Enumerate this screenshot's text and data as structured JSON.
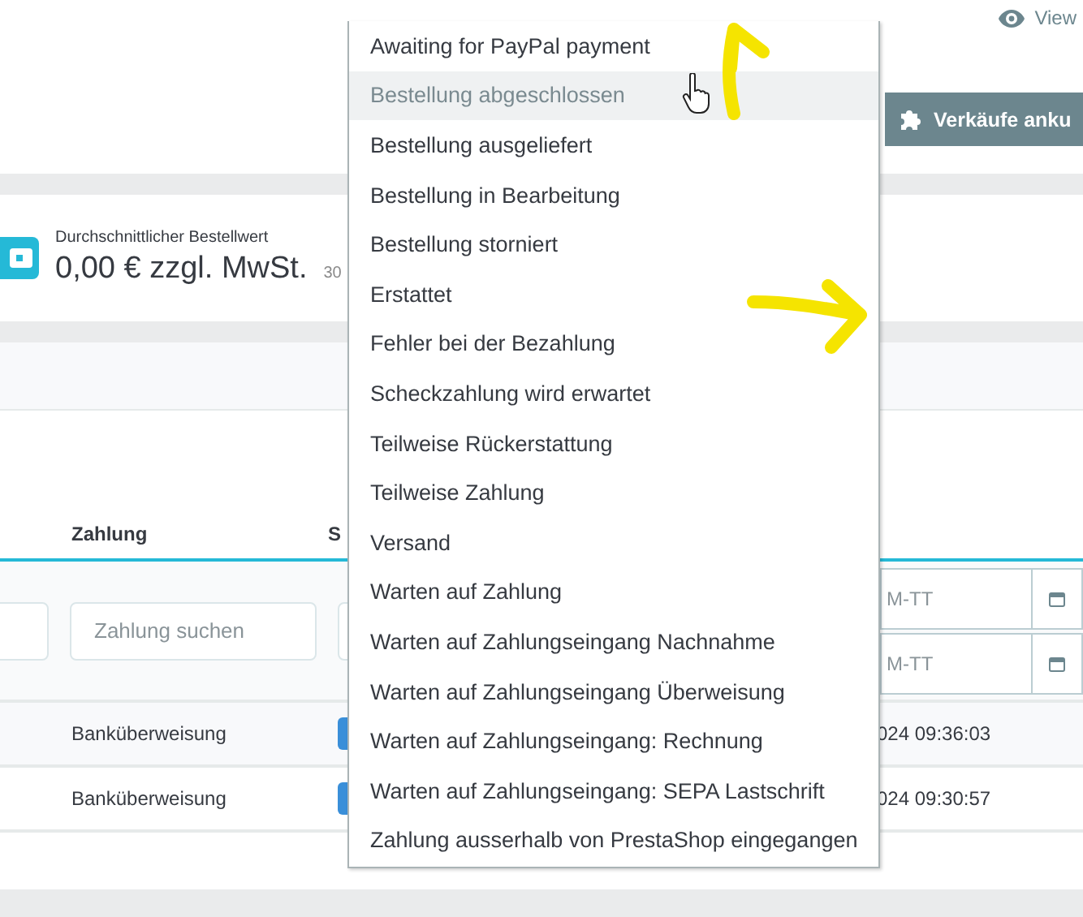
{
  "top_bar": {
    "view_link": "View"
  },
  "header_button": {
    "label": "Verkäufe anku"
  },
  "kpi": {
    "label": "Durchschnittlicher Bestellwert",
    "value": "0,00 € zzgl. MwSt.",
    "note": "30"
  },
  "table": {
    "columns": [
      {
        "label": "Zahlung"
      },
      {
        "label": "S"
      }
    ],
    "filters": {
      "payment_placeholder": "Zahlung suchen",
      "date_placeholders": [
        "M-TT",
        "M-TT"
      ]
    },
    "rows": [
      {
        "payment": "Banküberweisung",
        "date": "024 09:36:03"
      },
      {
        "payment": "Banküberweisung",
        "date": "024 09:30:57"
      }
    ]
  },
  "status_dropdown": {
    "items": [
      {
        "label": "Awaiting for PayPal payment",
        "selected": false
      },
      {
        "label": "Bestellung abgeschlossen",
        "selected": true
      },
      {
        "label": "Bestellung ausgeliefert",
        "selected": false
      },
      {
        "label": "Bestellung in Bearbeitung",
        "selected": false
      },
      {
        "label": "Bestellung storniert",
        "selected": false
      },
      {
        "label": "Erstattet",
        "selected": false
      },
      {
        "label": "Fehler bei der Bezahlung",
        "selected": false
      },
      {
        "label": "Scheckzahlung wird erwartet",
        "selected": false
      },
      {
        "label": "Teilweise Rückerstattung",
        "selected": false
      },
      {
        "label": "Teilweise Zahlung",
        "selected": false
      },
      {
        "label": "Versand",
        "selected": false
      },
      {
        "label": "Warten auf Zahlung",
        "selected": false
      },
      {
        "label": "Warten auf Zahlungseingang Nachnahme",
        "selected": false
      },
      {
        "label": "Warten auf Zahlungseingang Überweisung",
        "selected": false
      },
      {
        "label": "Warten auf Zahlungseingang: Rechnung",
        "selected": false
      },
      {
        "label": "Warten auf Zahlungseingang: SEPA Lastschrift",
        "selected": false
      },
      {
        "label": "Zahlung ausserhalb von PrestaShop eingegangen",
        "selected": false
      }
    ]
  }
}
